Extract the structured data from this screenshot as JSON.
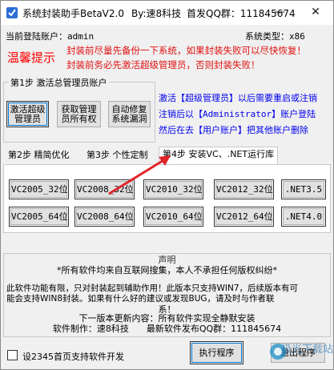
{
  "window": {
    "title_parts": [
      "系统封装助手BetaV2.0",
      "By:速8科技",
      "首发QQ群：111845674"
    ],
    "minimize": "—",
    "close": "✕"
  },
  "info": {
    "user_label": "当前登陆账户：admin",
    "arch_label": "系统类型：x86",
    "warm_tip": "温馨提示",
    "tip1": "封装前尽量先备份一下系统，如果封装失败可以尽快恢复！",
    "tip2": "封装前务必先激活超级管理员，否则封装失败！"
  },
  "step1": {
    "title": "第1步 激活总管理员账户",
    "btn_activate": [
      "激活超级",
      "管理员"
    ],
    "btn_ownership": [
      "获取管理",
      "员所有权"
    ],
    "btn_repair": [
      "自动修复",
      "系统漏洞"
    ],
    "note1": "激活【超级管理员】以后需要重启或注销",
    "note2": "注销后以【Administrator】账户登陆",
    "note3": "然后在去【用户账户】把其他账户删除"
  },
  "tabs": [
    "第2步 精简优化",
    "第3步 个性定制",
    "第4步 安装VC、.NET运行库"
  ],
  "vc_buttons_row1": [
    "VC2005_32位",
    "VC2008_32位",
    "VC2010_32位",
    "VC2012_32位",
    ".NET3.5"
  ],
  "vc_buttons_row2": [
    "VC2005_64位",
    "VC2008_64位",
    "VC2010_64位",
    "VC2012_64位",
    ".NET4.0"
  ],
  "notice": {
    "title": "声明",
    "line1": "*所有软件均来自互联网搜集，本人不承担任何版权纠纷*",
    "line2": "此软件功能有限，只对封装起到辅助作用！此版本只支持WIN7，后续版本有可",
    "line3": "能会支持WIN8封装。如果有什么好的建议或发现BUG，请及时与作者联",
    "line4": "系！",
    "line5": "下一版本更新内容：所有软件实现全静默安装",
    "line6": "软件制作：速8科技　　最新软件发布QQ群：111845674"
  },
  "footer": {
    "checkbox_label": "设2345首页支持软件开发",
    "run_button": "执行程序",
    "exit_button": "退出程序",
    "watermark": "极光下载站"
  },
  "colors": {
    "warning_red": "#ff0000",
    "link_blue": "#0000ee",
    "annotation_red": "#e0242a"
  }
}
